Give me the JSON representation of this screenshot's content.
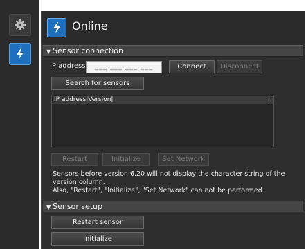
{
  "sidebar": {
    "buttons": [
      {
        "icon": "gear-icon"
      },
      {
        "icon": "lightning-icon"
      }
    ]
  },
  "header": {
    "title": "Online",
    "icon": "lightning-icon"
  },
  "sensor_connection": {
    "section_title": "Sensor connection",
    "ip_label": "IP address",
    "ip_placeholder": "___.___.___.___",
    "connect_label": "Connect",
    "disconnect_label": "Disconnect",
    "search_label": "Search for sensors",
    "list_header": "IP address|Version|",
    "restart_label": "Restart",
    "initialize_label": "Initialize",
    "set_network_label": "Set Network",
    "notes": [
      "Sensors before version 6.20 will not display the character string of the",
      "version column.",
      "Also, \"Restart\", \"Initialize\", \"Set Network\" can not be performed."
    ]
  },
  "sensor_setup": {
    "section_title": "Sensor setup",
    "restart_sensor_label": "Restart sensor",
    "initialize_label": "Initialize"
  },
  "colors": {
    "accent": "#1f6fbf",
    "panel": "#2e2e2e",
    "section": "#454545"
  }
}
